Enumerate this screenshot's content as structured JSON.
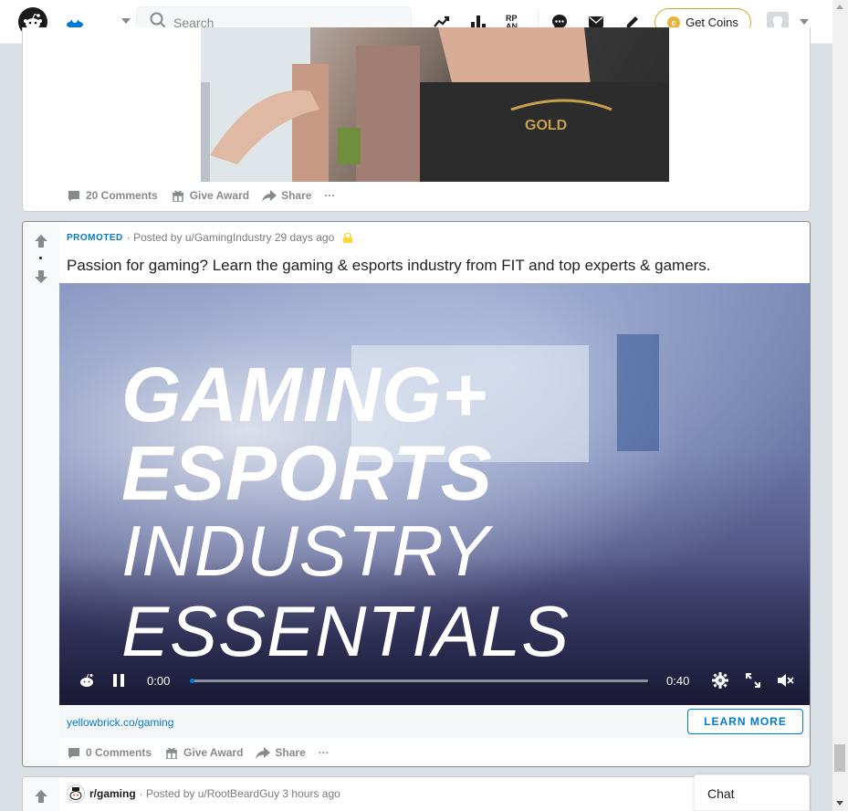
{
  "header": {
    "search_placeholder": "Search",
    "get_coins_label": "Get Coins",
    "coin_symbol": "c"
  },
  "post_prev": {
    "comments": "20 Comments",
    "give_award": "Give Award",
    "share": "Share",
    "more": "···"
  },
  "promoted_post": {
    "badge": "PROMOTED",
    "meta": "· Posted by u/GamingIndustry 29 days ago",
    "title": "Passion for gaming? Learn the gaming & esports industry from FIT and top experts & gamers.",
    "video": {
      "line1": "GAMING+",
      "line2": "ESPORTS",
      "line3": "INDUSTRY",
      "line4": "ESSENTIALS",
      "current_time": "0:00",
      "duration": "0:40",
      "progress": 0.0
    },
    "link": "yellowbrick.co/gaming",
    "cta": "LEARN MORE",
    "comments": "0 Comments",
    "give_award": "Give Award",
    "share": "Share",
    "more": "···"
  },
  "next_post": {
    "subreddit": "r/gaming",
    "meta": "· Posted by u/RootBeardGuy 3 hours ago"
  },
  "chat": {
    "label": "Chat"
  },
  "colors": {
    "accent": "#0079d3",
    "coin_border": "#d4a82a",
    "meta_gray": "#787c7e"
  }
}
